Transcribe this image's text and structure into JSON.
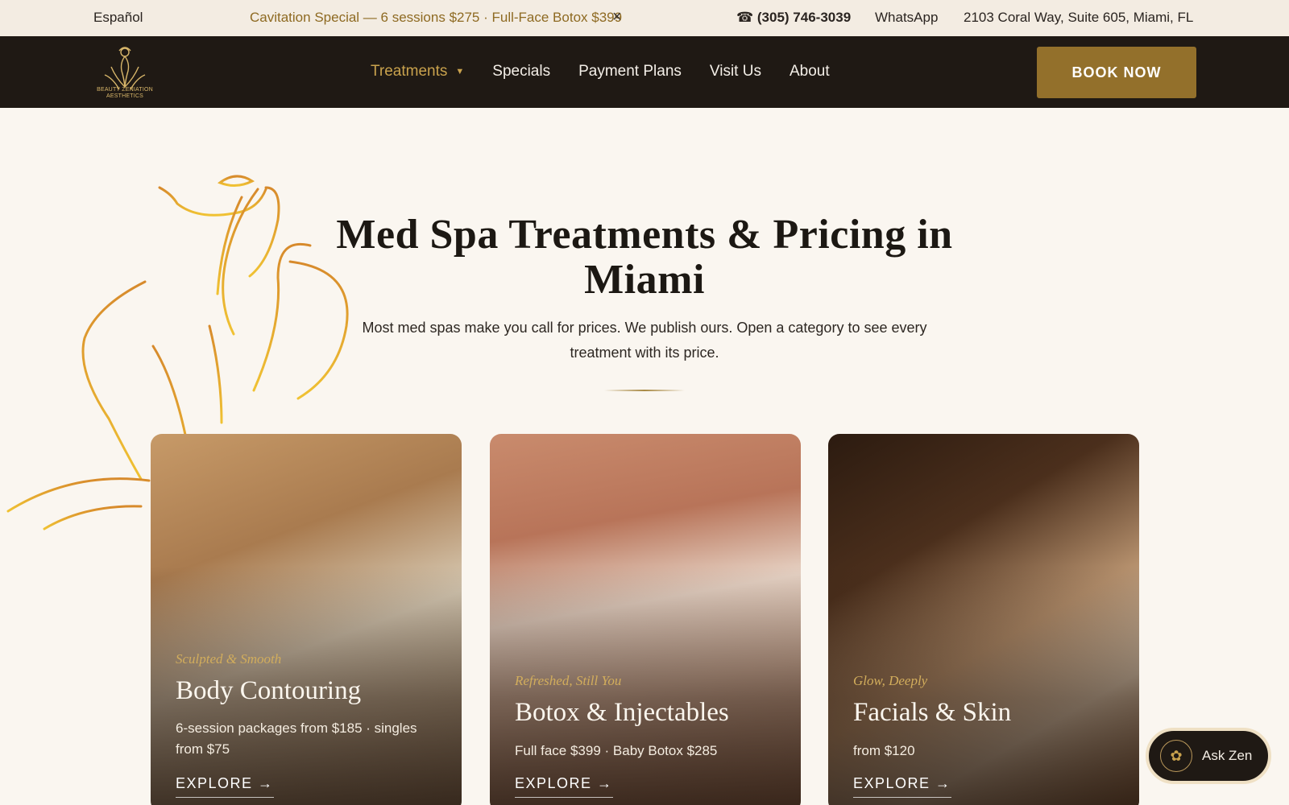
{
  "topbar": {
    "language": "Español",
    "promo": "Cavitation Special — 6 sessions $275 · Full-Face Botox $399",
    "close_icon": "×",
    "phone": "☎ (305) 746-3039",
    "whatsapp": "WhatsApp",
    "address": "2103 Coral Way, Suite 605, Miami, FL"
  },
  "nav": {
    "logo_text": "BEAUTY ZENIATION AESTHETICS",
    "items": [
      "Treatments",
      "Specials",
      "Payment Plans",
      "Visit Us",
      "About"
    ],
    "caret_icon": "▼",
    "book_label": "BOOK NOW"
  },
  "hero": {
    "title": "Med Spa Treatments & Pricing in Miami",
    "subtitle": "Most med spas make you call for prices. We publish ours. Open a category to see every treatment with its price."
  },
  "cards": [
    {
      "tagline": "Sculpted & Smooth",
      "title": "Body Contouring",
      "desc": "6-session packages from $185 · singles from $75",
      "cta": "EXPLORE →"
    },
    {
      "tagline": "Refreshed, Still You",
      "title": "Botox & Injectables",
      "desc": "Full face $399 · Baby Botox $285",
      "cta": "EXPLORE →"
    },
    {
      "tagline": "Glow, Deeply",
      "title": "Facials & Skin",
      "desc": "from $120",
      "cta": "EXPLORE →"
    }
  ],
  "chat": {
    "label": "Ask Zen"
  },
  "colors": {
    "gold": "#93702b",
    "dark": "#1f1914",
    "cream": "#faf6f0"
  }
}
